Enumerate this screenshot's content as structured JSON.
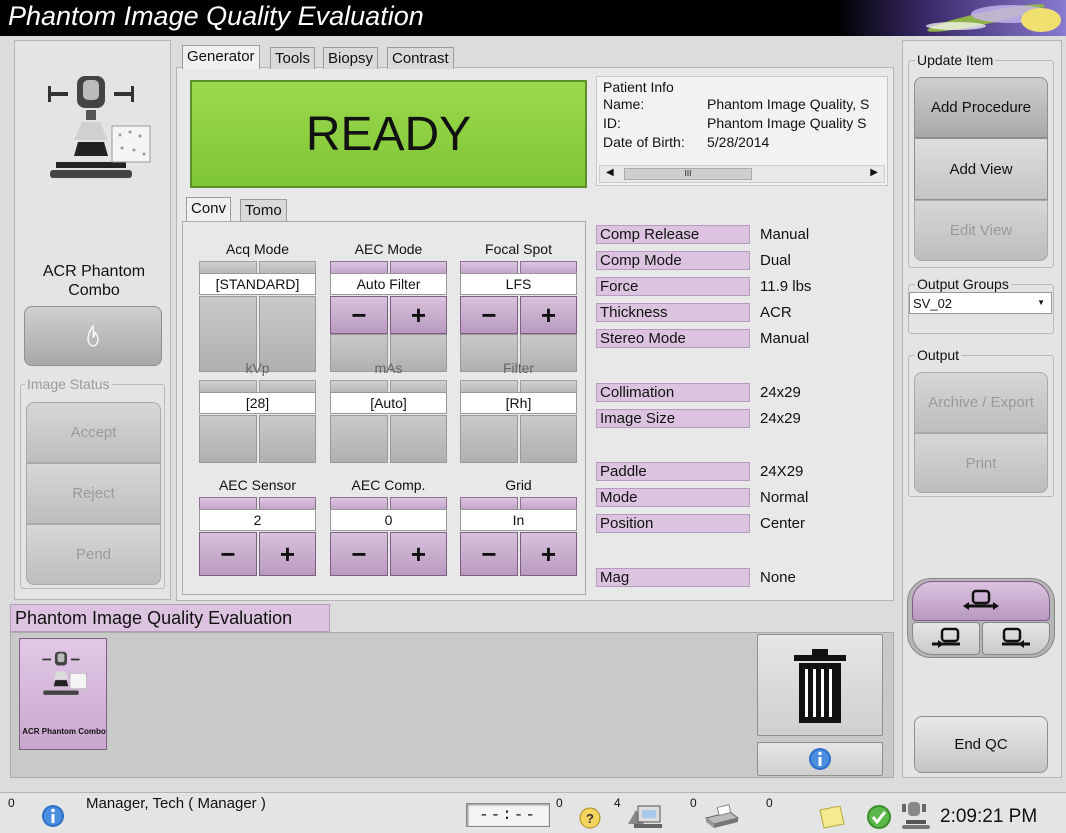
{
  "app": {
    "title": "Phantom Image Quality Evaluation"
  },
  "left": {
    "procedure_label": "ACR Phantom Combo",
    "image_status_label": "Image Status",
    "accept": "Accept",
    "reject": "Reject",
    "pend": "Pend"
  },
  "tabs": [
    "Generator",
    "Tools",
    "Biopsy",
    "Contrast"
  ],
  "ready_text": "READY",
  "patient": {
    "heading": "Patient Info",
    "name_label": "Name:",
    "name_value": "Phantom Image Quality, S",
    "id_label": "ID:",
    "id_value": "Phantom Image Quality S",
    "dob_label": "Date of Birth:",
    "dob_value": "5/28/2014",
    "scroll_grip": "III"
  },
  "subtabs": [
    "Conv",
    "Tomo"
  ],
  "controls": {
    "acq_mode": {
      "label": "Acq Mode",
      "value": "[STANDARD]"
    },
    "aec_mode": {
      "label": "AEC Mode",
      "value": "Auto Filter"
    },
    "focal_spot": {
      "label": "Focal Spot",
      "value": "LFS"
    },
    "kvp": {
      "label": "kVp",
      "value": "[28]"
    },
    "mas": {
      "label": "mAs",
      "value": "[Auto]"
    },
    "filter": {
      "label": "Filter",
      "value": "[Rh]"
    },
    "aec_sensor": {
      "label": "AEC Sensor",
      "value": "2"
    },
    "aec_comp": {
      "label": "AEC Comp.",
      "value": "0"
    },
    "grid": {
      "label": "Grid",
      "value": "In"
    },
    "minus": "−",
    "plus": "+"
  },
  "params": {
    "comp_release": {
      "label": "Comp Release",
      "value": "Manual"
    },
    "comp_mode": {
      "label": "Comp Mode",
      "value": "Dual"
    },
    "force": {
      "label": "Force",
      "value": "11.9 lbs"
    },
    "thickness": {
      "label": "Thickness",
      "value": "ACR"
    },
    "stereo_mode": {
      "label": "Stereo Mode",
      "value": "Manual"
    },
    "collimation": {
      "label": "Collimation",
      "value": "24x29"
    },
    "image_size": {
      "label": "Image Size",
      "value": "24x29"
    },
    "paddle": {
      "label": "Paddle",
      "value": "24X29"
    },
    "mode": {
      "label": "Mode",
      "value": "Normal"
    },
    "position": {
      "label": "Position",
      "value": "Center"
    },
    "mag": {
      "label": "Mag",
      "value": "None"
    }
  },
  "right": {
    "update_item": "Update Item",
    "add_procedure": "Add Procedure",
    "add_view": "Add View",
    "edit_view": "Edit View",
    "output_groups": "Output Groups",
    "output_group_value": "SV_02",
    "output": "Output",
    "archive_export": "Archive / Export",
    "print": "Print",
    "end_qc": "End QC"
  },
  "procedure_bar": {
    "title": "Phantom Image Quality Evaluation",
    "thumb_label": "ACR Phantom Combo"
  },
  "statusbar": {
    "count_info": "0",
    "user": "Manager, Tech ( Manager )",
    "timer": "--:--",
    "count_help": "0",
    "count_images": "4",
    "count_print": "0",
    "count_notes": "0",
    "clock": "2:09:21 PM"
  },
  "colors": {
    "ready_green": "#8ccf3f",
    "purple_button": "#c9adce",
    "param_label": "#dcc3e0"
  }
}
